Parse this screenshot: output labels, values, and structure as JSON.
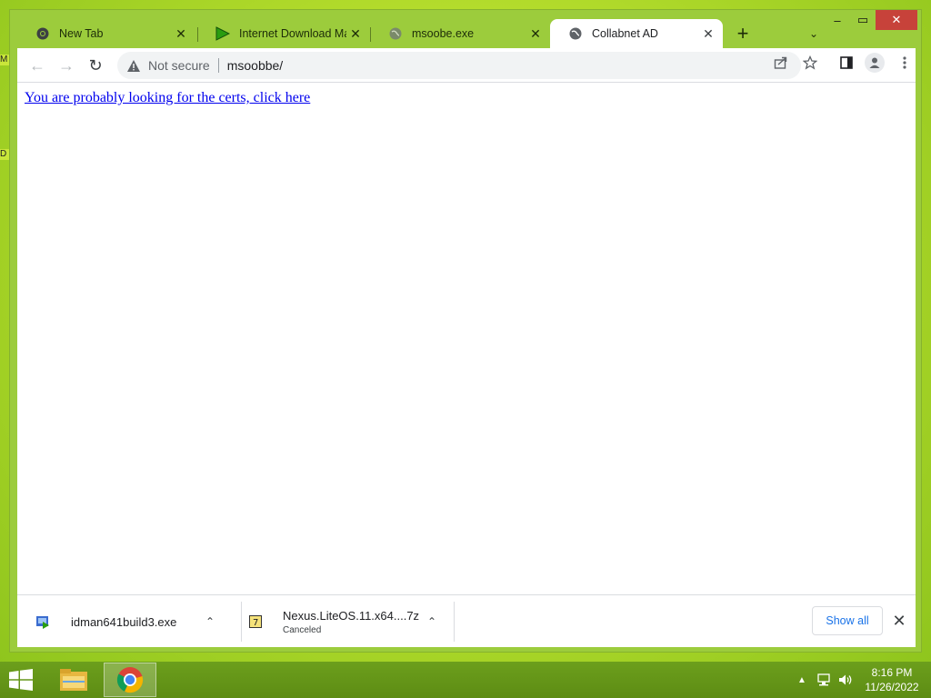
{
  "desktop": {
    "label_1": "M",
    "label_2": "D"
  },
  "window": {
    "controls": {
      "minimize": "–",
      "maximize": "▭",
      "close": "✕"
    }
  },
  "tabs": [
    {
      "title": "New Tab",
      "icon": "chrome-icon",
      "active": false
    },
    {
      "title": "Internet Download Manager",
      "icon": "idm-icon",
      "active": false
    },
    {
      "title": "msoobe.exe",
      "icon": "globe-icon",
      "active": false
    },
    {
      "title": "Collabnet AD",
      "icon": "globe-icon",
      "active": true
    }
  ],
  "tab_close_glyph": "✕",
  "new_tab_glyph": "+",
  "tab_search_glyph": "⌄",
  "toolbar": {
    "back_glyph": "←",
    "forward_glyph": "→",
    "reload_glyph": "↻",
    "security_label": "Not secure",
    "url": "msoobbe/"
  },
  "page": {
    "link_text": "You are probably looking for the certs, click here",
    "link_color": "#0000ee"
  },
  "downloads": {
    "items": [
      {
        "name": "idman641build3.exe",
        "status": ""
      },
      {
        "name": "Nexus.LiteOS.11.x64....7z",
        "status": "Canceled"
      }
    ],
    "show_all_label": "Show all",
    "close_glyph": "✕"
  },
  "taskbar": {
    "time": "8:16 PM",
    "date": "11/26/2022"
  },
  "colors": {
    "accent": "#1a73e8",
    "tabstrip": "#9ccc3c",
    "taskbar": "#6c9f1c",
    "close_button": "#c7423a"
  }
}
